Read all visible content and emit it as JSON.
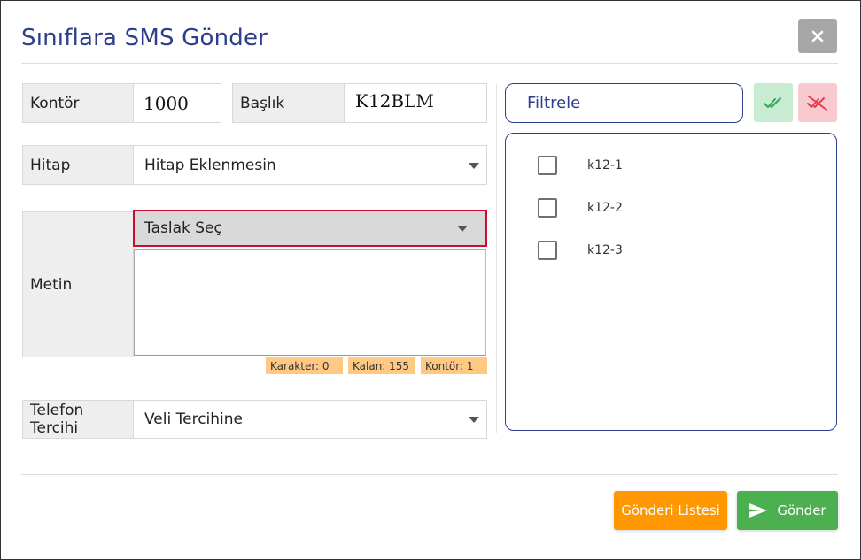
{
  "dialog": {
    "title": "Sınıflara SMS Gönder"
  },
  "form": {
    "kontor_label": "Kontör",
    "kontor_value": "1000",
    "baslik_label": "Başlık",
    "baslik_value": "K12BLM",
    "hitap_label": "Hitap",
    "hitap_value": "Hitap Eklenmesin",
    "metin_label": "Metin",
    "taslak_value": "Taslak Seç",
    "textarea_value": "",
    "counters": {
      "karakter": "Karakter: 0",
      "kalan": "Kalan: 155",
      "kontor": "Kontör: 1"
    },
    "telefon_label": "Telefon Tercihi",
    "telefon_value": "Veli Tercihine"
  },
  "classes": {
    "filter_placeholder": "Filtrele",
    "items": [
      {
        "label": "k12-1",
        "checked": false
      },
      {
        "label": "k12-2",
        "checked": false
      },
      {
        "label": "k12-3",
        "checked": false
      }
    ]
  },
  "footer": {
    "list_button": "Gönderi Listesi",
    "send_button": "Gönder"
  },
  "colors": {
    "title": "#2c3e8c",
    "accent_red": "#c8102e",
    "badge": "#ffc983",
    "orange": "#ff9800",
    "green": "#4caf50",
    "select_all_bg": "#c8ecd2",
    "deselect_all_bg": "#f8c9cf"
  },
  "icons": {
    "close": "close-icon",
    "select_all": "double-check-icon",
    "deselect_all": "double-check-cross-icon",
    "send": "paper-plane-icon",
    "dropdown": "caret-down-icon"
  }
}
